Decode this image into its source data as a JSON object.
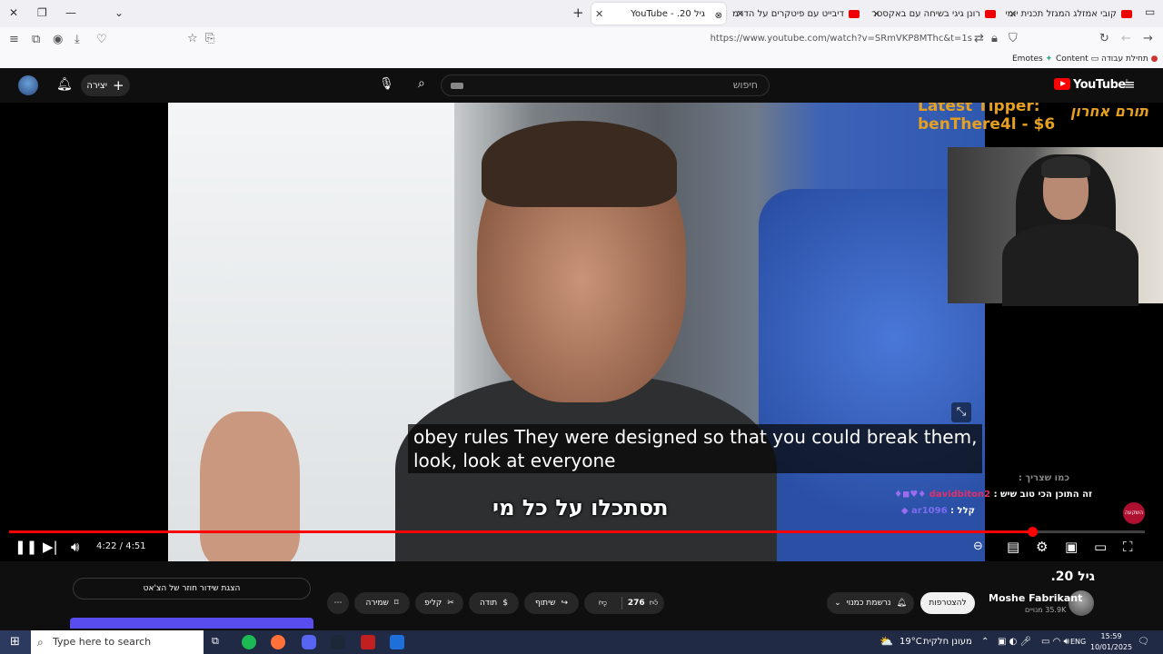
{
  "browser": {
    "tabs": [
      {
        "label": "קובי אמזלג המגזל תכנית יומית כ",
        "active": false
      },
      {
        "label": "רונן גיגי בשיחה עם באקסטר בליי",
        "active": false
      },
      {
        "label": "דיבייט עם פיטקרים על הדרמה, כ",
        "active": false
      },
      {
        "label": "גיל 20. - YouTube",
        "active": true
      }
    ],
    "url": "https://www.youtube.com/watch?v=SRmVKP8MThc&t=1s",
    "bookmarks": {
      "emotes": "Emotes",
      "content": "Content",
      "work_start": "תחילת עבודה"
    }
  },
  "youtube": {
    "logo": "YouTube",
    "logo_region": "IL",
    "search_placeholder": "חיפוש",
    "create_label": "יצירה"
  },
  "player": {
    "subtitle_en_line1": "obey rules  They were designed so that you could break them,",
    "subtitle_en_line2": "look, look at everyone",
    "subtitle_heb": "תסתכלו על כל מי",
    "tipper_label": "Latest Tipper:",
    "tipper_name": "benThere4l - $6",
    "tipper_heb": "תורם אחרון",
    "chat": [
      {
        "text": "כמו שצריך :"
      },
      {
        "user": "davidbiton2",
        "text": "זה התוכן הכי טוב שיש :"
      },
      {
        "user": "ar1096",
        "text": "קלל :"
      }
    ],
    "chat_badge": "השקעה",
    "current_time": "4:22",
    "duration": "4:51",
    "progress": 0.901
  },
  "below": {
    "title": "גיל 20.",
    "channel": "Moshe Fabrikant",
    "subscribers": "35.9K מנויים",
    "subscribe": "להצטרפות",
    "subscribed": "נרשמת כמנוי",
    "likes": "276",
    "share": "שיתוף",
    "thanks": "תודה",
    "clip": "קליפ",
    "save": "שמירה",
    "chat_replay": "הצגת שידור חוזר של הצ'אט"
  },
  "taskbar": {
    "search_placeholder": "Type here to search",
    "weather": "19°C",
    "weather_desc": "מעונן חלקית",
    "lang": "ENG",
    "time": "15:59",
    "date": "10/01/2025"
  }
}
